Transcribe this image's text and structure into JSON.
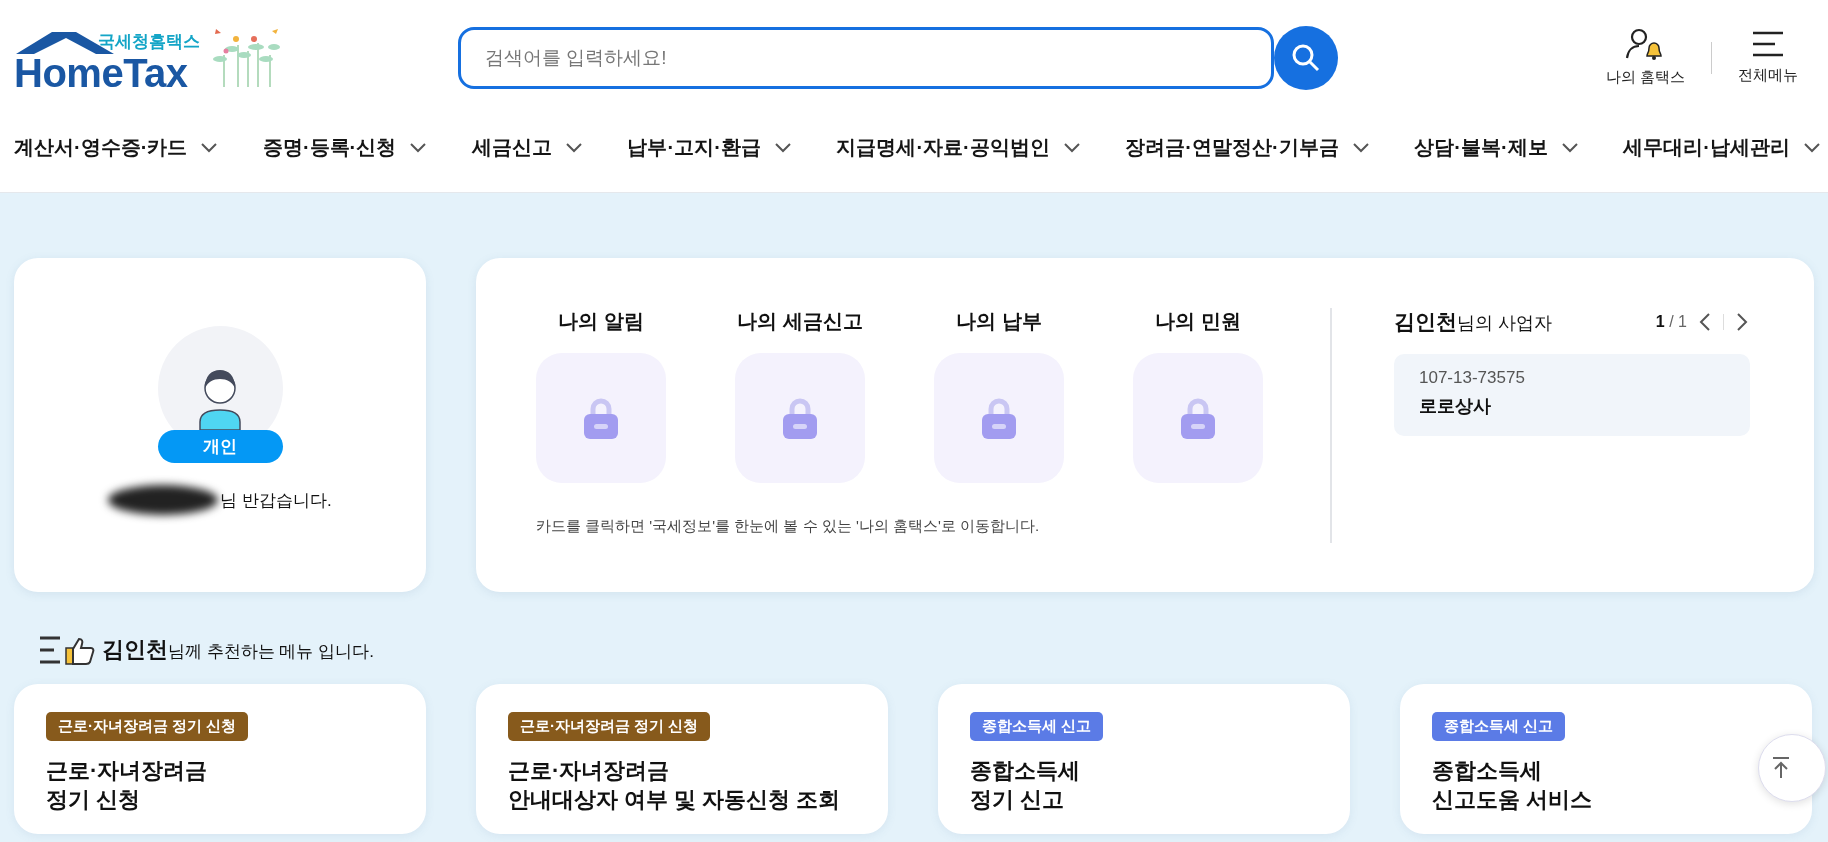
{
  "logo": {
    "subtitle": "국세청홈택스",
    "title": "HomeTax"
  },
  "search": {
    "placeholder": "검색어를 입력하세요!"
  },
  "header_actions": [
    {
      "kind": "user",
      "label": "나의 홈택스"
    },
    {
      "kind": "menu",
      "label": "전체메뉴"
    }
  ],
  "nav": [
    {
      "label": "계산서·영수증·카드"
    },
    {
      "label": "증명·등록·신청"
    },
    {
      "label": "세금신고"
    },
    {
      "label": "납부·고지·환급"
    },
    {
      "label": "지급명세·자료·공익법인"
    },
    {
      "label": "장려금·연말정산·기부금"
    },
    {
      "label": "상담·불복·제보"
    },
    {
      "label": "세무대리·납세관리"
    }
  ],
  "profile": {
    "badge": "개인",
    "greeting": "님 반갑습니다."
  },
  "my_cards": [
    {
      "title": "나의 알림"
    },
    {
      "title": "나의 세금신고"
    },
    {
      "title": "나의 납부"
    },
    {
      "title": "나의 민원"
    }
  ],
  "my_cards_note": "카드를 클릭하면 '국세정보'를 한눈에 볼 수 있는 '나의 홈택스'로 이동합니다.",
  "business": {
    "heading": "**김인천**님의 사업자",
    "pager": "**1** / 1",
    "items": [
      {
        "number": "107-13-73575",
        "name": "로로상사"
      }
    ]
  },
  "recommend": {
    "heading": "**김인천**님께 추천하는 메뉴 입니다."
  },
  "menu_cards": [
    {
      "tag": "근로·자녀장려금 정기 신청",
      "color": "#875a1c",
      "title": [
        "근로·자녀장려금",
        "정기 신청"
      ]
    },
    {
      "tag": "근로·자녀장려금 정기 신청",
      "color": "#875a1c",
      "title": [
        "근로·자녀장려금",
        "안내대상자 여부 및 자동신청 조회"
      ]
    },
    {
      "tag": "종합소득세 신고",
      "color": "#5b7be6",
      "title": [
        "종합소득세",
        "정기 신고"
      ]
    },
    {
      "tag": "종합소득세 신고",
      "color": "#5b7be6",
      "title": [
        "종합소득세",
        "신고도움 서비스"
      ]
    }
  ]
}
